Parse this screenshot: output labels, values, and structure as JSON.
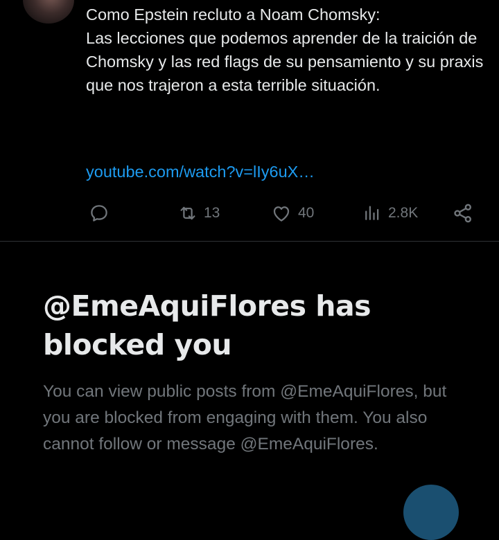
{
  "tweet": {
    "text": "Como Epstein recluto a Noam Chomsky:\nLas lecciones que podemos aprender de la traición de Chomsky y las red flags de su pensamiento y su praxis que nos trajeron a esta terrible situación.",
    "link": "youtube.com/watch?v=lIy6uX…"
  },
  "actions": {
    "reply": {
      "icon": "reply-icon"
    },
    "retweet": {
      "icon": "retweet-icon",
      "count": "13"
    },
    "like": {
      "icon": "heart-icon",
      "count": "40"
    },
    "views": {
      "icon": "views-icon",
      "count": "2.8K"
    },
    "share": {
      "icon": "share-icon"
    }
  },
  "blocked": {
    "title": "@EmeAquiFlores has blocked you",
    "description": "You can view public posts from @EmeAquiFlores, but you are blocked from engaging with them. You also cannot follow or message @EmeAquiFlores."
  },
  "colors": {
    "background": "#000000",
    "text": "#e7e9ea",
    "muted": "#71767b",
    "link": "#1d9bf0",
    "divider": "#2f3336"
  }
}
